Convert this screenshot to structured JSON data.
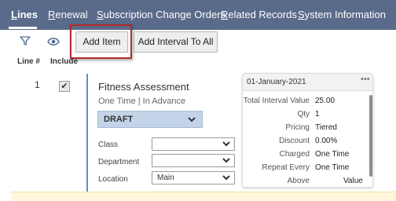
{
  "tabs": [
    {
      "lead": "L",
      "rest": "ines"
    },
    {
      "lead": "R",
      "rest": "enewal"
    },
    {
      "lead": "S",
      "rest": "ubscription Change Orders"
    },
    {
      "lead": "R",
      "rest": "elated Records"
    },
    {
      "lead": "S",
      "rest": "ystem Information"
    }
  ],
  "toolbar": {
    "filter_icon": "filter-icon",
    "view_icon": "eye-icon",
    "add_item": "Add Item",
    "add_interval": "Add Interval To All"
  },
  "columns": {
    "line": "Line #",
    "include": "Include"
  },
  "line": {
    "number": "1",
    "include_checked": true,
    "check_glyph": "✔",
    "item_name": "Fitness Assessment",
    "item_sub": "One Time | In Advance",
    "status": "DRAFT",
    "fields": [
      {
        "label": "Class",
        "value": ""
      },
      {
        "label": "Department",
        "value": ""
      },
      {
        "label": "Location",
        "value": "Main"
      }
    ]
  },
  "interval": {
    "date": "01-January-2021",
    "menu": "•••",
    "rows": [
      {
        "label": "Total Interval Value",
        "value": "25.00"
      },
      {
        "label": "Qty",
        "value": "1"
      },
      {
        "label": "Pricing",
        "value": "Tiered"
      },
      {
        "label": "Discount",
        "value": "0.00%"
      },
      {
        "label": "Charged",
        "value": "One Time"
      },
      {
        "label": "Repeat Every",
        "value": "One Time"
      },
      {
        "label": "Above",
        "value": "Value"
      }
    ]
  },
  "colors": {
    "tabbar": "#5a6a8a",
    "accent": "#5b8ed2",
    "status_bg": "#c3d4e9",
    "highlight": "#b32b2b"
  }
}
